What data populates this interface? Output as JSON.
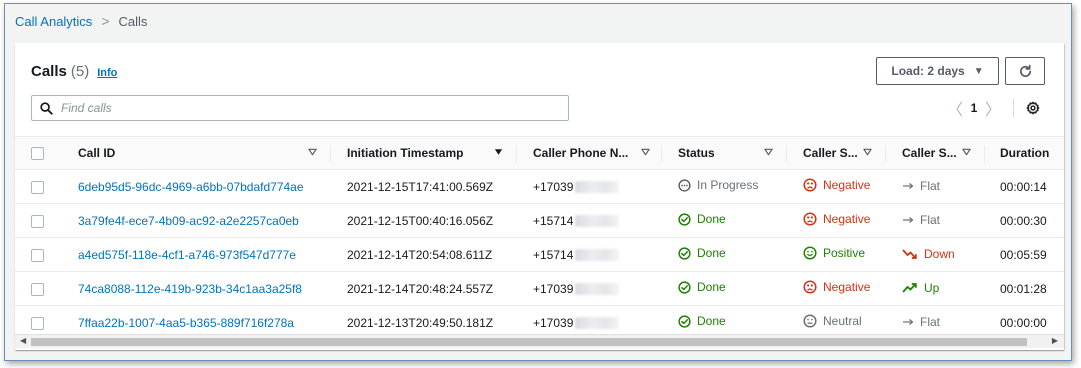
{
  "breadcrumb": {
    "root": "Call Analytics",
    "separator": ">",
    "current": "Calls"
  },
  "panel": {
    "title": "Calls",
    "count": "(5)",
    "info": "Info",
    "load_button": "Load: 2 days",
    "load_caret": "▼",
    "refresh_icon": "refresh-icon"
  },
  "search": {
    "placeholder": "Find calls",
    "value": ""
  },
  "pagination": {
    "prev": "〈",
    "page": "1",
    "next": "〉"
  },
  "table": {
    "columns": [
      {
        "label": "Call ID",
        "sort": "filter"
      },
      {
        "label": "Initiation Timestamp",
        "sort": "sorted-desc"
      },
      {
        "label": "Caller Phone N...",
        "sort": "filter"
      },
      {
        "label": "Status",
        "sort": "filter"
      },
      {
        "label": "Caller S...",
        "sort": "filter"
      },
      {
        "label": "Caller S...",
        "sort": "filter"
      },
      {
        "label": "Duration",
        "sort": "none"
      }
    ],
    "rows": [
      {
        "call_id": "6deb95d5-96dc-4969-a6bb-07bdafd774ae",
        "timestamp": "2021-12-15T17:41:00.569Z",
        "phone": "+17039",
        "status": "In Progress",
        "status_kind": "progress",
        "sentiment": "Negative",
        "sentiment_kind": "negative",
        "trend": "Flat",
        "trend_kind": "flat",
        "duration": "00:00:14"
      },
      {
        "call_id": "3a79fe4f-ece7-4b09-ac92-a2e2257ca0eb",
        "timestamp": "2021-12-15T00:40:16.056Z",
        "phone": "+15714",
        "status": "Done",
        "status_kind": "done",
        "sentiment": "Negative",
        "sentiment_kind": "negative",
        "trend": "Flat",
        "trend_kind": "flat",
        "duration": "00:00:30"
      },
      {
        "call_id": "a4ed575f-118e-4cf1-a746-973f547d777e",
        "timestamp": "2021-12-14T20:54:08.611Z",
        "phone": "+15714",
        "status": "Done",
        "status_kind": "done",
        "sentiment": "Positive",
        "sentiment_kind": "positive",
        "trend": "Down",
        "trend_kind": "down",
        "duration": "00:05:59"
      },
      {
        "call_id": "74ca8088-112e-419b-923b-34c1aa3a25f8",
        "timestamp": "2021-12-14T20:48:24.557Z",
        "phone": "+17039",
        "status": "Done",
        "status_kind": "done",
        "sentiment": "Negative",
        "sentiment_kind": "negative",
        "trend": "Up",
        "trend_kind": "up",
        "duration": "00:01:28"
      },
      {
        "call_id": "7ffaa22b-1007-4aa5-b365-889f716f278a",
        "timestamp": "2021-12-13T20:49:50.181Z",
        "phone": "+17039",
        "status": "Done",
        "status_kind": "done",
        "sentiment": "Neutral",
        "sentiment_kind": "neutral",
        "trend": "Flat",
        "trend_kind": "flat",
        "duration": "00:00:00"
      }
    ]
  },
  "colors": {
    "link": "#0073bb",
    "success": "#1d8102",
    "error": "#d13212",
    "muted": "#687078"
  }
}
